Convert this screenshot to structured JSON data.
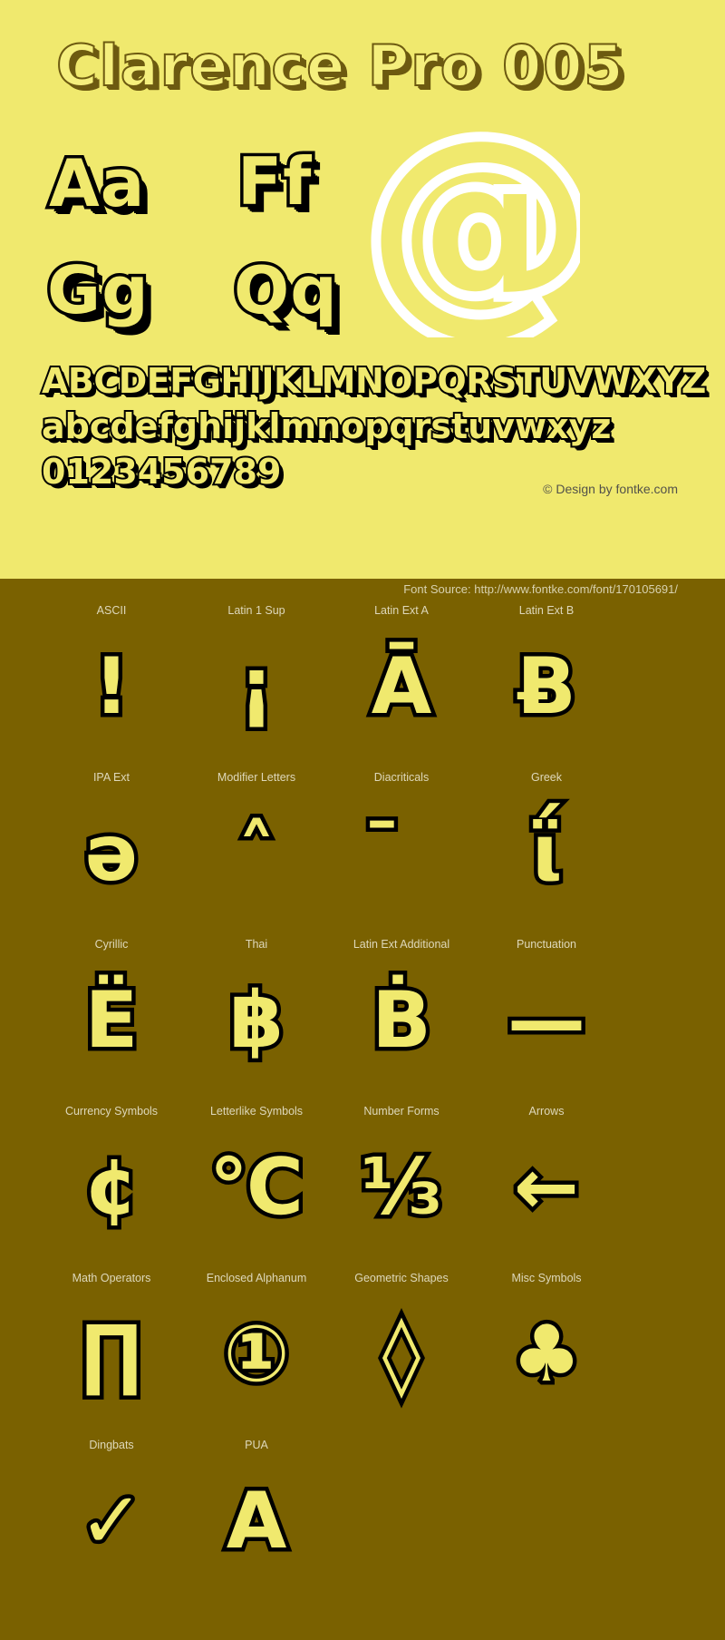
{
  "page": {
    "background_color": "#7a6100",
    "specimen_background": "#f0e96e",
    "outline_color": "#000000",
    "title_outline_color": "#6d5a10",
    "at_sign_color": "#ffffff"
  },
  "specimen": {
    "title": "Clarence Pro 005",
    "samples": [
      {
        "name": "sample-aa",
        "text": "Aa"
      },
      {
        "name": "sample-ff",
        "text": "Ff"
      },
      {
        "name": "sample-gg",
        "text": "Gg"
      },
      {
        "name": "sample-qq",
        "text": "Qq"
      }
    ],
    "feature_glyph": "@",
    "uppercase": "ABCDEFGHIJKLMNOPQRSTUVWXYZ",
    "lowercase": "abcdefghijklmnopqrstuvwxyz",
    "digits": "0123456789",
    "copyright": "© Design by fontke.com"
  },
  "source": {
    "text": "Font Source: http://www.fontke.com/font/170105691/"
  },
  "glyph_grid": {
    "rows": [
      [
        {
          "label": "ASCII",
          "glyph": "!"
        },
        {
          "label": "Latin 1 Sup",
          "glyph": "¡"
        },
        {
          "label": "Latin Ext A",
          "glyph": "Ā"
        },
        {
          "label": "Latin Ext B",
          "glyph": "Ƀ"
        }
      ],
      [
        {
          "label": "IPA Ext",
          "glyph": "ə"
        },
        {
          "label": "Modifier Letters",
          "glyph": "˄"
        },
        {
          "label": "Diacriticals",
          "glyph": "̄"
        },
        {
          "label": "Greek",
          "glyph": "ΐ"
        }
      ],
      [
        {
          "label": "Cyrillic",
          "glyph": "Ё"
        },
        {
          "label": "Thai",
          "glyph": "฿"
        },
        {
          "label": "Latin Ext Additional",
          "glyph": "Ḃ"
        },
        {
          "label": "Punctuation",
          "glyph": "—"
        }
      ],
      [
        {
          "label": "Currency Symbols",
          "glyph": "¢"
        },
        {
          "label": "Letterlike Symbols",
          "glyph": "℃"
        },
        {
          "label": "Number Forms",
          "glyph": "⅓"
        },
        {
          "label": "Arrows",
          "glyph": "←"
        }
      ],
      [
        {
          "label": "Math Operators",
          "glyph": "∏"
        },
        {
          "label": "Enclosed Alphanum",
          "glyph": "①"
        },
        {
          "label": "Geometric Shapes",
          "glyph": "◊"
        },
        {
          "label": "Misc Symbols",
          "glyph": "♣"
        }
      ],
      [
        {
          "label": "Dingbats",
          "glyph": "✓"
        },
        {
          "label": "PUA",
          "glyph": "A"
        }
      ]
    ]
  }
}
